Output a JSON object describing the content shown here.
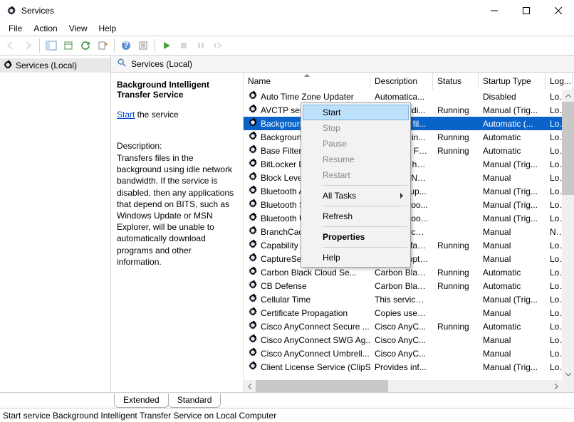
{
  "window": {
    "title": "Services"
  },
  "menubar": [
    "File",
    "Action",
    "View",
    "Help"
  ],
  "tree": {
    "root": "Services (Local)"
  },
  "content_header": "Services (Local)",
  "detail": {
    "selected_name": "Background Intelligent Transfer Service",
    "action_link": "Start",
    "action_suffix": " the service",
    "description_label": "Description:",
    "description_text": "Transfers files in the background using idle network bandwidth. If the service is disabled, then any applications that depend on BITS, such as Windows Update or MSN Explorer, will be unable to automatically download programs and other information."
  },
  "columns": {
    "name": "Name",
    "description": "Description",
    "status": "Status",
    "startup": "Startup Type",
    "logon": "Log..."
  },
  "services": [
    {
      "name": "Auto Time Zone Updater",
      "description": "Automatica...",
      "status": "",
      "startup": "Disabled",
      "logon": "Loc..."
    },
    {
      "name": "AVCTP service",
      "description": "This is Audi...",
      "status": "Running",
      "startup": "Manual (Trig...",
      "logon": "Loc..."
    },
    {
      "name": "Background Intelligent T...",
      "description": "Transfers fil...",
      "status": "",
      "startup": "Automatic (...",
      "logon": "Loc...",
      "selected": true
    },
    {
      "name": "Background Tasks Infra...",
      "description": "Windows in...",
      "status": "Running",
      "startup": "Automatic",
      "logon": "Loc..."
    },
    {
      "name": "Base Filtering Engine",
      "description": "The Base Fil...",
      "status": "Running",
      "startup": "Automatic",
      "logon": "Loc..."
    },
    {
      "name": "BitLocker Drive Encrypt...",
      "description": "BDESVC hos...",
      "status": "",
      "startup": "Manual (Trig...",
      "logon": "Loc..."
    },
    {
      "name": "Block Level Backup Eng...",
      "description": "The WBENG...",
      "status": "",
      "startup": "Manual",
      "logon": "Loc..."
    },
    {
      "name": "Bluetooth Audio Gatew...",
      "description": "Service sup...",
      "status": "",
      "startup": "Manual (Trig...",
      "logon": "Loc..."
    },
    {
      "name": "Bluetooth Support Serv...",
      "description": "The Bluetoo...",
      "status": "",
      "startup": "Manual (Trig...",
      "logon": "Loc..."
    },
    {
      "name": "Bluetooth User Support...",
      "description": "The Bluetoo...",
      "status": "",
      "startup": "Manual (Trig...",
      "logon": "Loc..."
    },
    {
      "name": "BranchCache",
      "description": "This service ...",
      "status": "",
      "startup": "Manual",
      "logon": "Net..."
    },
    {
      "name": "Capability Access Man...",
      "description": "Provides fac...",
      "status": "Running",
      "startup": "Manual",
      "logon": "Loc..."
    },
    {
      "name": "CaptureService_4d00e",
      "description": "Enables opti...",
      "status": "",
      "startup": "Manual",
      "logon": "Loc..."
    },
    {
      "name": "Carbon Black Cloud Se...",
      "description": "Carbon Blac...",
      "status": "Running",
      "startup": "Automatic",
      "logon": "Loc..."
    },
    {
      "name": "CB Defense",
      "description": "Carbon Blac...",
      "status": "Running",
      "startup": "Automatic",
      "logon": "Loc..."
    },
    {
      "name": "Cellular Time",
      "description": "This service ...",
      "status": "",
      "startup": "Manual (Trig...",
      "logon": "Loc..."
    },
    {
      "name": "Certificate Propagation",
      "description": "Copies user ...",
      "status": "",
      "startup": "Manual",
      "logon": "Loc..."
    },
    {
      "name": "Cisco AnyConnect Secure ...",
      "description": "Cisco AnyC...",
      "status": "Running",
      "startup": "Automatic",
      "logon": "Loc..."
    },
    {
      "name": "Cisco AnyConnect SWG Ag...",
      "description": "Cisco AnyC...",
      "status": "",
      "startup": "Manual",
      "logon": "Loc..."
    },
    {
      "name": "Cisco AnyConnect Umbrell...",
      "description": "Cisco AnyC...",
      "status": "",
      "startup": "Manual",
      "logon": "Loc..."
    },
    {
      "name": "Client License Service (ClipS...",
      "description": "Provides inf...",
      "status": "",
      "startup": "Manual (Trig...",
      "logon": "Loc..."
    }
  ],
  "context_menu": [
    {
      "label": "Start",
      "type": "item",
      "enabled": true,
      "highlight": true
    },
    {
      "label": "Stop",
      "type": "item",
      "enabled": false
    },
    {
      "label": "Pause",
      "type": "item",
      "enabled": false
    },
    {
      "label": "Resume",
      "type": "item",
      "enabled": false
    },
    {
      "label": "Restart",
      "type": "item",
      "enabled": false
    },
    {
      "type": "sep"
    },
    {
      "label": "All Tasks",
      "type": "sub",
      "enabled": true
    },
    {
      "type": "sep"
    },
    {
      "label": "Refresh",
      "type": "item",
      "enabled": true
    },
    {
      "type": "sep"
    },
    {
      "label": "Properties",
      "type": "item",
      "enabled": true,
      "bold": true
    },
    {
      "type": "sep"
    },
    {
      "label": "Help",
      "type": "item",
      "enabled": true
    }
  ],
  "tabs": {
    "extended": "Extended",
    "standard": "Standard"
  },
  "statusbar": "Start service Background Intelligent Transfer Service on Local Computer"
}
